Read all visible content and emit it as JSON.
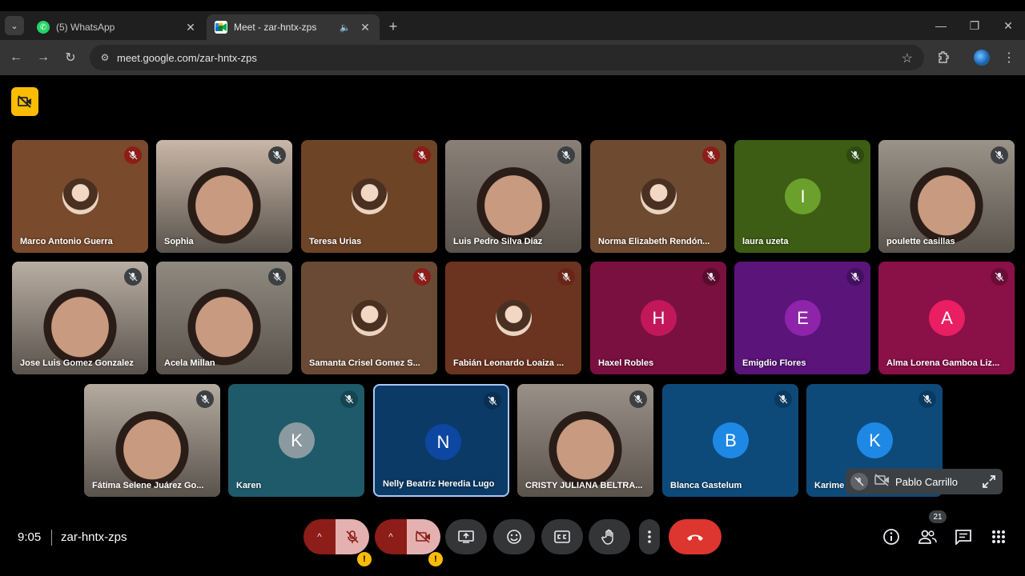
{
  "browser": {
    "tabs": [
      {
        "title": "(5) WhatsApp",
        "icon": "whatsapp-icon",
        "active": false
      },
      {
        "title": "Meet - zar-hntx-zps",
        "icon": "google-meet-icon",
        "active": true
      }
    ],
    "url": "meet.google.com/zar-hntx-zps"
  },
  "participants": [
    {
      "name": "Marco Antonio Guerra",
      "kind": "photo",
      "bg": "#7a4a2d",
      "mic_bg": "#8c1d18"
    },
    {
      "name": "Sophia",
      "kind": "video",
      "bg": "#c9b7a8",
      "mic_bg": "#3c4043"
    },
    {
      "name": "Teresa Urias",
      "kind": "photo",
      "bg": "#6e4426",
      "mic_bg": "#8c1d18"
    },
    {
      "name": "Luis Pedro Silva Diaz",
      "kind": "video",
      "bg": "#8a8078",
      "mic_bg": "#3c4043"
    },
    {
      "name": "Norma Elizabeth Rendón...",
      "kind": "photo",
      "bg": "#6e4a30",
      "mic_bg": "#8c1d18"
    },
    {
      "name": "laura uzeta",
      "kind": "letter",
      "letter": "I",
      "bg": "#3d5c14",
      "avatar_bg": "#6aa02b",
      "mic_bg": "#2e4a10"
    },
    {
      "name": "poulette casillas",
      "kind": "video",
      "bg": "#9a9388",
      "mic_bg": "#3c4043"
    },
    {
      "name": "Jose Luis Gomez Gonzalez",
      "kind": "video",
      "bg": "#b9aea3",
      "mic_bg": "#3c4043"
    },
    {
      "name": "Acela Millan",
      "kind": "video",
      "bg": "#8f8a80",
      "mic_bg": "#3c4043"
    },
    {
      "name": "Samanta Crisel Gomez S...",
      "kind": "photo",
      "bg": "#6a4a35",
      "mic_bg": "#8c1d18"
    },
    {
      "name": "Fabián Leonardo Loaiza ...",
      "kind": "photo",
      "bg": "#6b3420",
      "mic_bg": "#6b2418"
    },
    {
      "name": "Haxel Robles",
      "kind": "letter",
      "letter": "H",
      "bg": "#7a1040",
      "avatar_bg": "#c2185b",
      "mic_bg": "#5a0c30"
    },
    {
      "name": "Emigdio Flores",
      "kind": "letter",
      "letter": "E",
      "bg": "#5a147a",
      "avatar_bg": "#8e24aa",
      "mic_bg": "#431060"
    },
    {
      "name": "Alma Lorena Gamboa Liz...",
      "kind": "letter",
      "letter": "A",
      "bg": "#8a1048",
      "avatar_bg": "#e91e63",
      "mic_bg": "#6a0c38"
    },
    {
      "name": "Fátima Selene Juárez Go...",
      "kind": "video",
      "bg": "#b5aba0",
      "mic_bg": "#3c4043"
    },
    {
      "name": "Karen",
      "kind": "letter",
      "letter": "K",
      "bg": "#1f5a6a",
      "avatar_bg": "#8b9aa0",
      "mic_bg": "#154550"
    },
    {
      "name": "Nelly Beatriz Heredia Lugo",
      "kind": "letter",
      "letter": "N",
      "bg": "#0b3a66",
      "avatar_bg": "#0d47a1",
      "mic_bg": "#0a2f52",
      "selected": true
    },
    {
      "name": "CRISTY JULIANA BELTRA...",
      "kind": "video",
      "bg": "#9a9088",
      "mic_bg": "#3c4043"
    },
    {
      "name": "Blanca Gastelum",
      "kind": "letter",
      "letter": "B",
      "bg": "#0d4a7a",
      "avatar_bg": "#1e88e5",
      "mic_bg": "#0a3a60"
    },
    {
      "name": "Karime",
      "kind": "letter",
      "letter": "K",
      "bg": "#0d4a7a",
      "avatar_bg": "#1e88e5",
      "mic_bg": "#0a3a60"
    }
  ],
  "self_view": {
    "name": "Pablo Carrillo"
  },
  "bottom": {
    "time": "9:05",
    "meeting_code": "zar-hntx-zps",
    "participant_count": "21",
    "warning_mark": "!"
  }
}
